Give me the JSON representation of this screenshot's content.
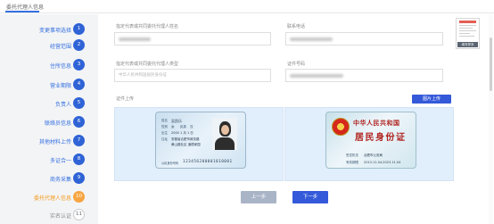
{
  "header": {
    "title": "委托代理人信息"
  },
  "sidebar": {
    "steps": [
      {
        "label": "变更事项选择",
        "num": "1",
        "state": "done"
      },
      {
        "label": "经营范围",
        "num": "2",
        "state": "done"
      },
      {
        "label": "住所信息",
        "num": "3",
        "state": "done"
      },
      {
        "label": "营业期限",
        "num": "4",
        "state": "done"
      },
      {
        "label": "负责人",
        "num": "5",
        "state": "done"
      },
      {
        "label": "联络员信息",
        "num": "6",
        "state": "done"
      },
      {
        "label": "其他材料上传",
        "num": "7",
        "state": "done"
      },
      {
        "label": "多证合一",
        "num": "8",
        "state": "done"
      },
      {
        "label": "商务采集",
        "num": "9",
        "state": "done"
      },
      {
        "label": "委托代理人信息",
        "num": "10",
        "state": "active"
      },
      {
        "label": "实名认证",
        "num": "11",
        "state": "todo"
      }
    ]
  },
  "form": {
    "name": {
      "label": "指定代表或共同委托代理人姓名"
    },
    "phone": {
      "label": "联系电话"
    },
    "cert_type": {
      "label": "指定代表或共同委托代理人类型",
      "value": "中华人民共和国居民身份证"
    },
    "cert_no": {
      "label": "证件号码"
    },
    "upload": {
      "label": "证件上传",
      "button": "图片上传"
    }
  },
  "thumb": {
    "label": "填写样本"
  },
  "id_front": {
    "name_label": "姓名",
    "name": "吴凯乐",
    "gender_label": "性别",
    "gender": "女",
    "ethnic_label": "民族",
    "ethnic": "汉",
    "birth_label": "出生",
    "birth": "2000 1 月 1 日",
    "addr_label": "住址",
    "addr1": "安徽省合肥市政务路",
    "addr2": "黄山路社区 道德家园",
    "id_label": "公民身份号码",
    "id_number": "123456200001010001"
  },
  "id_back": {
    "title1": "中华人民共和国",
    "title2": "居民身份证",
    "authority_label": "签发机关",
    "authority": "合肥市公安局",
    "validity_label": "有效期限",
    "validity": "2013.11.04-2023.11.04"
  },
  "buttons": {
    "prev": "上一步",
    "next": "下一步"
  }
}
